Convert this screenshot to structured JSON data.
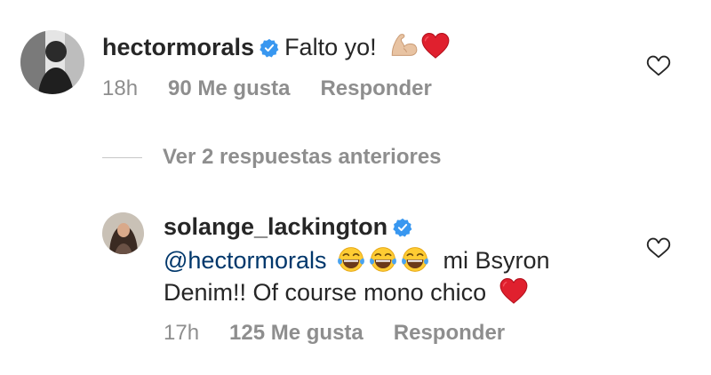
{
  "comment1": {
    "username": "hectormorals",
    "verified": true,
    "text": "Falto yo!",
    "emojis": [
      "flexed-biceps",
      "red-heart"
    ],
    "time": "18h",
    "likes": "90 Me gusta",
    "reply": "Responder"
  },
  "view_replies": "Ver 2 respuestas anteriores",
  "comment2": {
    "username": "solange_lackington",
    "verified": true,
    "mention": "@hectormorals",
    "text_part1": "mi Bsyron",
    "text_part2": "Denim!! Of course mono chico",
    "emojis": [
      "tears-of-joy",
      "tears-of-joy",
      "tears-of-joy",
      "red-heart"
    ],
    "time": "17h",
    "likes": "125 Me gusta",
    "reply": "Responder"
  },
  "colors": {
    "verified_blue": "#3897f0",
    "mention": "#00376b",
    "meta_gray": "#8e8e8e",
    "heart_red": "#e0202e"
  }
}
